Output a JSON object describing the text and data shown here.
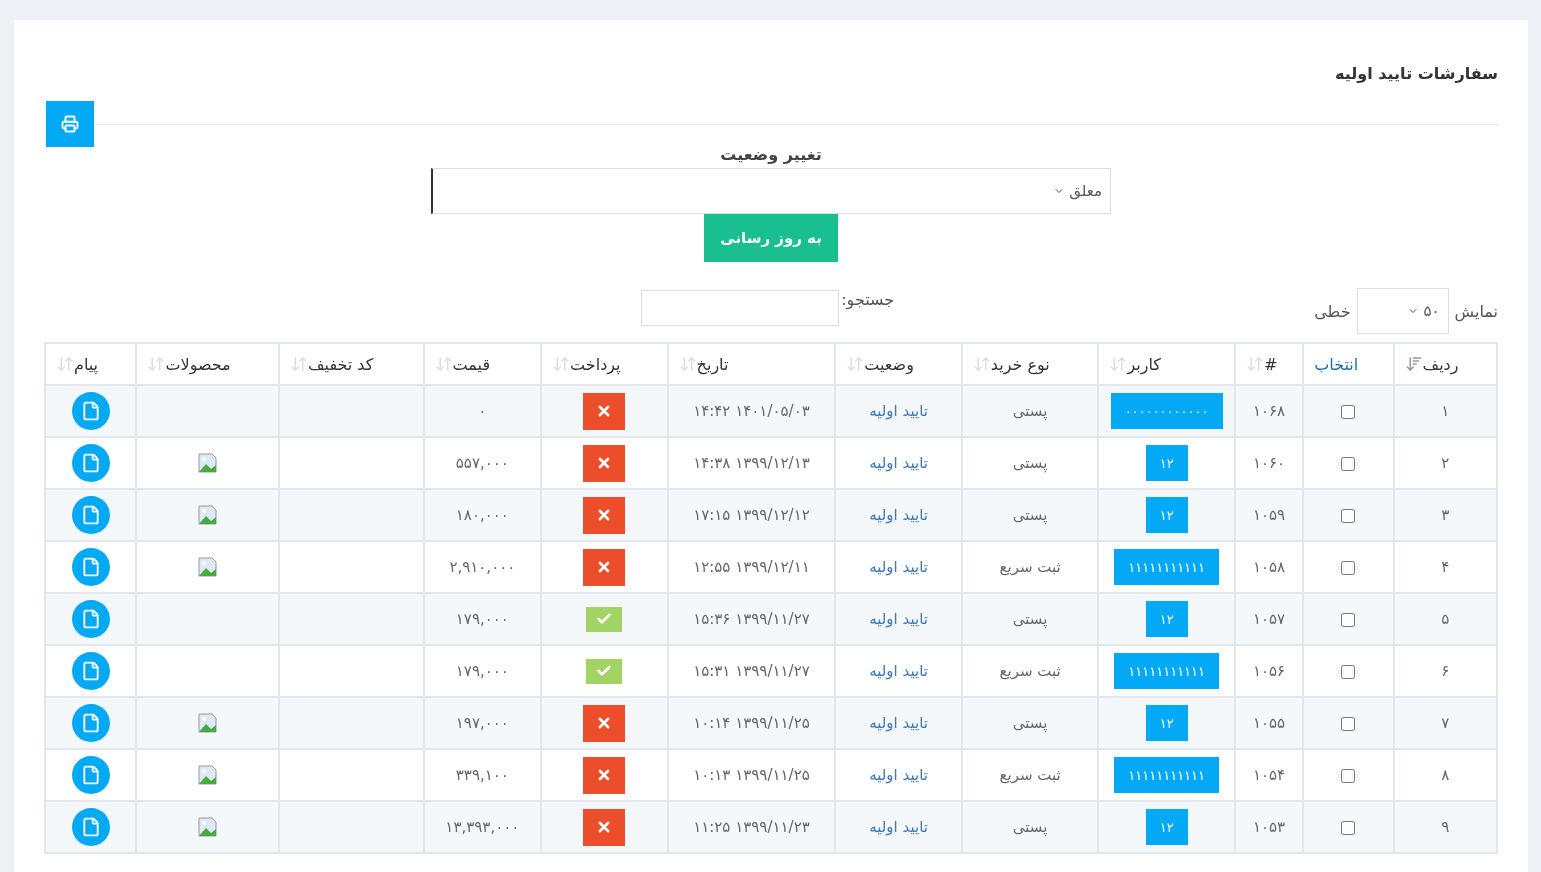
{
  "page": {
    "title": "سفارشات تایید اولیه"
  },
  "status_form": {
    "label": "تغییر وضعیت",
    "select_value": "معلق",
    "button": "به روز رسانی"
  },
  "length_control": {
    "label_before": "نمایش",
    "value": "۵۰",
    "label_after": "خطی"
  },
  "search": {
    "label": "جستجو:"
  },
  "table": {
    "columns": [
      {
        "label": "ردیف",
        "kind": "sorted"
      },
      {
        "label": "انتخاب",
        "kind": "select"
      },
      {
        "label": "#",
        "kind": "sortable"
      },
      {
        "label": "کاربر",
        "kind": "sortable"
      },
      {
        "label": "نوع خرید",
        "kind": "sortable"
      },
      {
        "label": "وضعیت",
        "kind": "sortable"
      },
      {
        "label": "تاریخ",
        "kind": "sortable"
      },
      {
        "label": "پرداخت",
        "kind": "sortable"
      },
      {
        "label": "قیمت",
        "kind": "sortable"
      },
      {
        "label": "کد تخفیف",
        "kind": "sortable"
      },
      {
        "label": "محصولات",
        "kind": "sortable"
      },
      {
        "label": "پیام",
        "kind": "sortable"
      }
    ],
    "rows": [
      {
        "row": "۱",
        "checked": false,
        "id": "۱۰۶۸",
        "user": "۰۰۰۰۰۰۰۰۰۰۰۰",
        "purchase_type": "پستی",
        "status": "تایید اولیه",
        "date": "۱۴۰۱/۰۵/۰۳ ۱۴:۴۲",
        "paid": false,
        "price": "۰",
        "has_image": false
      },
      {
        "row": "۲",
        "checked": false,
        "id": "۱۰۶۰",
        "user": "۱۲",
        "purchase_type": "پستی",
        "status": "تایید اولیه",
        "date": "۱۳۹۹/۱۲/۱۳ ۱۴:۳۸",
        "paid": false,
        "price": "۵۵۷,۰۰۰",
        "has_image": true
      },
      {
        "row": "۳",
        "checked": false,
        "id": "۱۰۵۹",
        "user": "۱۲",
        "purchase_type": "پستی",
        "status": "تایید اولیه",
        "date": "۱۳۹۹/۱۲/۱۲ ۱۷:۱۵",
        "paid": false,
        "price": "۱۸۰,۰۰۰",
        "has_image": true
      },
      {
        "row": "۴",
        "checked": false,
        "id": "۱۰۵۸",
        "user": "۱۱۱۱۱۱۱۱۱۱۱",
        "purchase_type": "ثبت سریع",
        "status": "تایید اولیه",
        "date": "۱۳۹۹/۱۲/۱۱ ۱۲:۵۵",
        "paid": false,
        "price": "۲,۹۱۰,۰۰۰",
        "has_image": true
      },
      {
        "row": "۵",
        "checked": false,
        "id": "۱۰۵۷",
        "user": "۱۲",
        "purchase_type": "پستی",
        "status": "تایید اولیه",
        "date": "۱۳۹۹/۱۱/۲۷ ۱۵:۳۶",
        "paid": true,
        "price": "۱۷۹,۰۰۰",
        "has_image": false
      },
      {
        "row": "۶",
        "checked": false,
        "id": "۱۰۵۶",
        "user": "۱۱۱۱۱۱۱۱۱۱۱",
        "purchase_type": "ثبت سریع",
        "status": "تایید اولیه",
        "date": "۱۳۹۹/۱۱/۲۷ ۱۵:۳۱",
        "paid": true,
        "price": "۱۷۹,۰۰۰",
        "has_image": false
      },
      {
        "row": "۷",
        "checked": false,
        "id": "۱۰۵۵",
        "user": "۱۲",
        "purchase_type": "پستی",
        "status": "تایید اولیه",
        "date": "۱۳۹۹/۱۱/۲۵ ۱۰:۱۴",
        "paid": false,
        "price": "۱۹۷,۰۰۰",
        "has_image": true
      },
      {
        "row": "۸",
        "checked": false,
        "id": "۱۰۵۴",
        "user": "۱۱۱۱۱۱۱۱۱۱۱",
        "purchase_type": "ثبت سریع",
        "status": "تایید اولیه",
        "date": "۱۳۹۹/۱۱/۲۵ ۱۰:۱۳",
        "paid": false,
        "price": "۳۳۹,۱۰۰",
        "has_image": true
      },
      {
        "row": "۹",
        "checked": false,
        "id": "۱۰۵۳",
        "user": "۱۲",
        "purchase_type": "پستی",
        "status": "تایید اولیه",
        "date": "۱۳۹۹/۱۱/۲۳ ۱۱:۲۵",
        "paid": false,
        "price": "۱۳,۳۹۳,۰۰۰",
        "has_image": true
      }
    ]
  }
}
